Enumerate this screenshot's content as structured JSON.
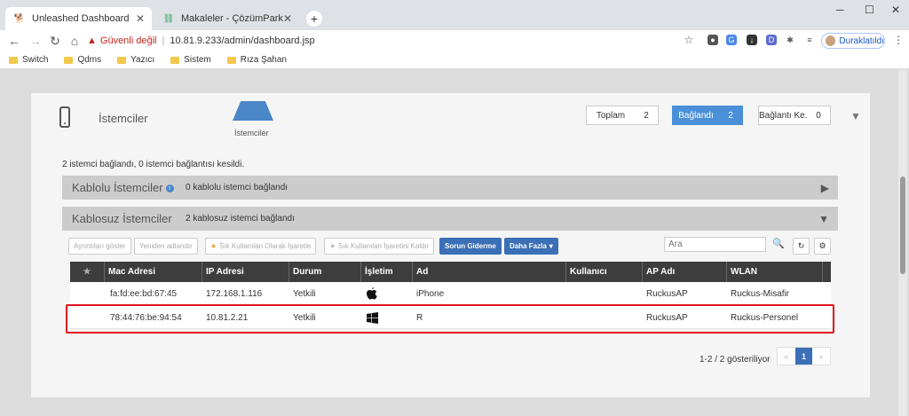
{
  "browser": {
    "tabs": [
      {
        "title": "Unleashed Dashboard",
        "active": true
      },
      {
        "title": "Makaleler - ÇözümPark",
        "active": false
      }
    ],
    "address": {
      "security_label": "Güvenli değil",
      "separator": "|",
      "url": "10.81.9.233/admin/dashboard.jsp"
    },
    "profile_label": "Duraklatıldı",
    "bookmarks": [
      "Switch",
      "Qdms",
      "Yazıcı",
      "Sistem",
      "Rıza Şahan"
    ]
  },
  "dashboard": {
    "section_title": "İstemciler",
    "cloud_label": "İstemciler",
    "counters": [
      {
        "label": "Toplam",
        "value": "2",
        "active": false
      },
      {
        "label": "Bağlandı",
        "value": "2",
        "active": true
      },
      {
        "label": "Bağlantı Ke...",
        "value": "0",
        "active": false
      }
    ],
    "summary": "2 istemci bağlandı, 0 istemci bağlantısı kesildi.",
    "wired": {
      "title": "Kablolu İstemciler",
      "desc": "0 kablolu istemci bağlandı"
    },
    "wireless": {
      "title": "Kablosuz İstemciler",
      "desc": "2 kablosuz istemci bağlandı"
    },
    "actions": {
      "details": "Ayrıntıları göster",
      "rename": "Yeniden adlandır",
      "mark_fav": "Sık Kullanılan Olarak İşaretle",
      "unmark_fav": "Sık Kullanılan İşaretini Kaldır",
      "troubleshoot": "Sorun Giderme",
      "more": "Daha Fazla"
    },
    "search_placeholder": "Ara",
    "table": {
      "headers": [
        "Mac Adresi",
        "IP Adresi",
        "Durum",
        "İşletim",
        "Ad",
        "Kullanıcı",
        "AP Adı",
        "WLAN"
      ],
      "rows": [
        {
          "mac": "fa:fd:ee:bd:67:45",
          "ip": "172.168.1.116",
          "status": "Yetkili",
          "os": "apple-icon",
          "name": "iPhone",
          "user": "",
          "ap": "RuckusAP",
          "wlan": "Ruckus-Misafir"
        },
        {
          "mac": "78:44:76:be:94:54",
          "ip": "10.81.2.21",
          "status": "Yetkili",
          "os": "windows-icon",
          "name": "R",
          "user": "",
          "ap": "RuckusAP",
          "wlan": "Ruckus-Personel"
        }
      ]
    },
    "pagination": {
      "info": "1-2 / 2 gösteriliyor",
      "prev": "«",
      "current": "1",
      "next": "»"
    }
  }
}
